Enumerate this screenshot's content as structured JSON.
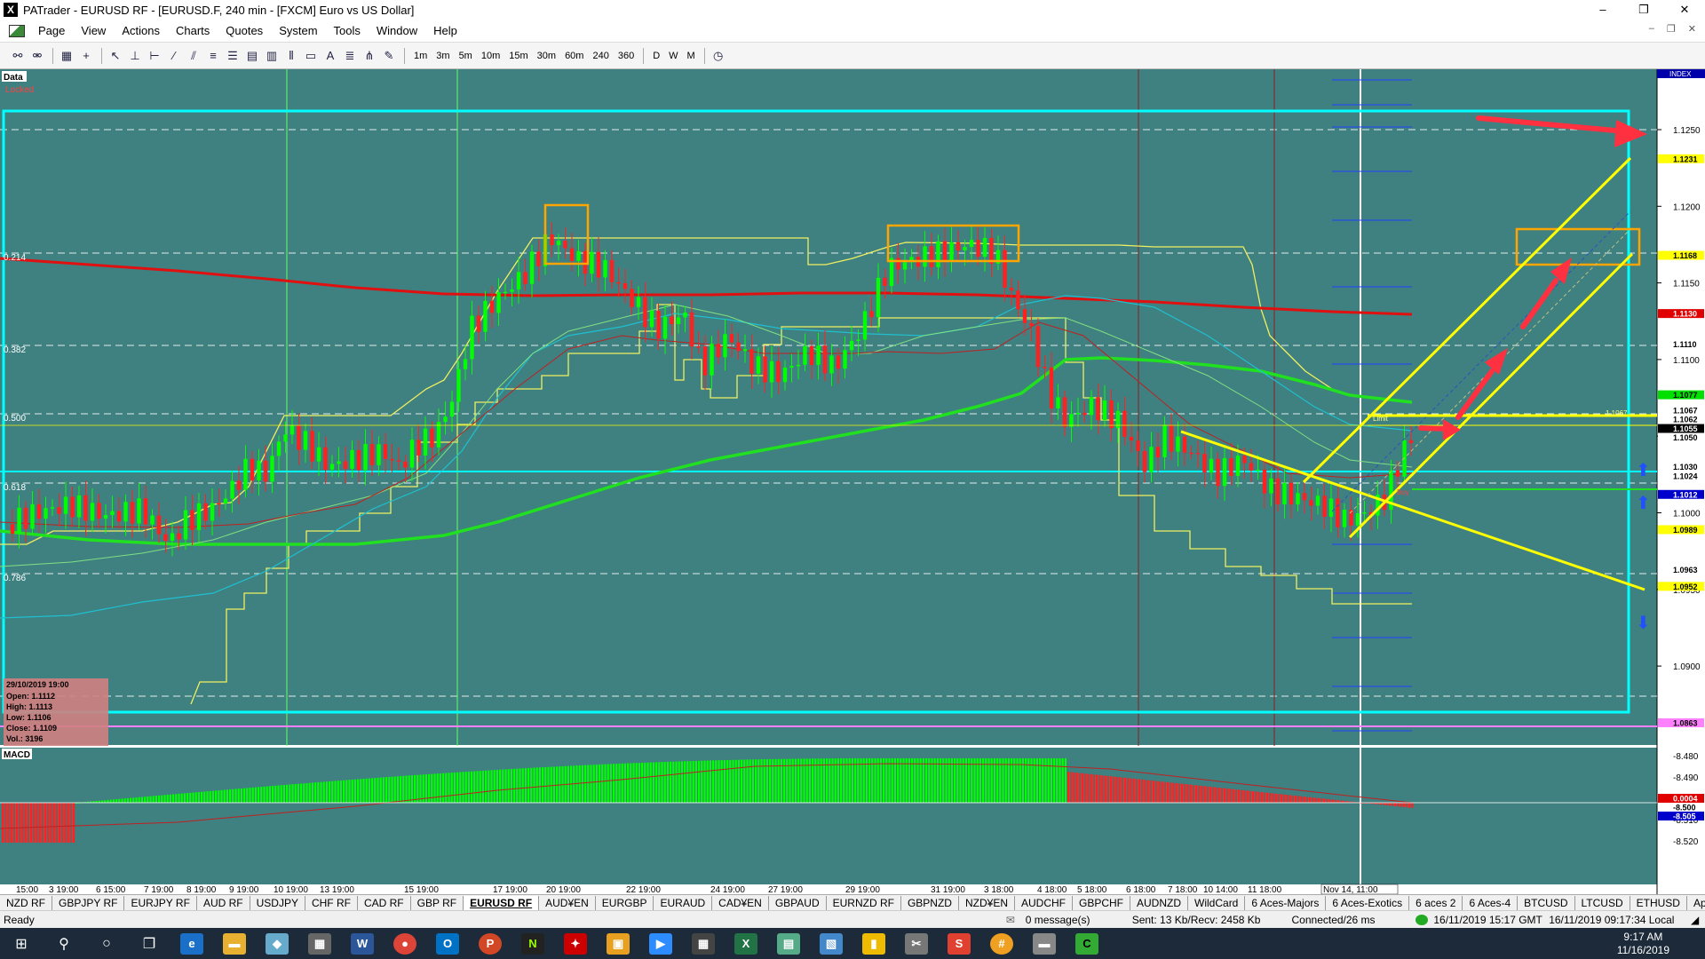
{
  "window": {
    "title": "PATrader - EURUSD RF - [EURUSD.F, 240 min - [FXCM] Euro vs US Dollar]",
    "app_icon": "X",
    "minimize": "–",
    "restore": "❐",
    "close": "✕"
  },
  "menu": [
    "Page",
    "View",
    "Actions",
    "Charts",
    "Quotes",
    "System",
    "Tools",
    "Window",
    "Help"
  ],
  "mdi": {
    "minimize": "–",
    "restore": "❐",
    "close": "✕"
  },
  "toolbar": {
    "timeframes": [
      "1m",
      "3m",
      "5m",
      "10m",
      "15m",
      "30m",
      "60m",
      "240",
      "360",
      "D",
      "W",
      "M"
    ]
  },
  "chart": {
    "data_label": "Data",
    "locked_label": "Locked",
    "index_label": "INDEX",
    "macd_label": "MACD",
    "y_ticks": [
      "1.1250",
      "1.1200",
      "1.1150",
      "1.1100",
      "1.1050",
      "1.1000",
      "1.0950",
      "1.0900"
    ],
    "price_tags": [
      {
        "text": "1.1231",
        "bg": "#ffff00",
        "color": "#000"
      },
      {
        "text": "1.1168",
        "bg": "#ffff00",
        "color": "#000"
      },
      {
        "text": "1.1130",
        "bg": "#e00000",
        "color": "#fff"
      },
      {
        "text": "1.1110",
        "bg": "#ffffff",
        "color": "#000"
      },
      {
        "text": "1.1077",
        "bg": "#00e000",
        "color": "#000"
      },
      {
        "text": "1.1067",
        "bg": "#ffffff",
        "color": "#000"
      },
      {
        "text": "1.1062",
        "bg": "#ffffff",
        "color": "#000"
      },
      {
        "text": "1.1055",
        "bg": "#000000",
        "color": "#fff"
      },
      {
        "text": "1.1050",
        "bg": "#ffffff",
        "color": "#000"
      },
      {
        "text": "1.1030",
        "bg": "#ffffff",
        "color": "#000"
      },
      {
        "text": "1.1024",
        "bg": "#ffffff",
        "color": "#000"
      },
      {
        "text": "1.1012",
        "bg": "#0000cc",
        "color": "#fff"
      },
      {
        "text": "1.0989",
        "bg": "#ffff00",
        "color": "#000"
      },
      {
        "text": "1.0963",
        "bg": "#ffffff",
        "color": "#000"
      },
      {
        "text": "1.0952",
        "bg": "#ffff00",
        "color": "#000"
      },
      {
        "text": "1.0863",
        "bg": "#ff80ff",
        "color": "#000"
      }
    ],
    "fib_labels": [
      "0.214",
      "0.382",
      "0.500",
      "0.618",
      "0.786"
    ],
    "macd_ticks": [
      "-8.480",
      "-8.490",
      "-8.500",
      "-8.510",
      "-8.520"
    ],
    "macd_tags": [
      {
        "text": "0.0004",
        "bg": "#e00000",
        "color": "#fff"
      },
      {
        "text": "-8.500",
        "bg": "#ffffff",
        "color": "#000"
      },
      {
        "text": "-8.505",
        "bg": "#0000cc",
        "color": "#fff"
      }
    ],
    "x_labels": [
      "15:00",
      "3 19:00",
      "6 15:00",
      "7 19:00",
      "8 19:00",
      "9 19:00",
      "10 19:00",
      "13 19:00",
      "15 19:00",
      "17 19:00",
      "20 19:00",
      "22 19:00",
      "24 19:00",
      "27 19:00",
      "29 19:00",
      "31 19:00",
      "3 18:00",
      "4 18:00",
      "5 18:00",
      "6 18:00",
      "7 18:00",
      "10 14:00",
      "11 18:00"
    ],
    "cursor_time": "Nov 14, 11:00",
    "small_labels": {
      "limit": "Limit",
      "buy": "Buy",
      "level": "1.1067"
    },
    "ohlc": {
      "date": "29/10/2019 19:00",
      "open": "Open: 1.1112",
      "high": "High: 1.1113",
      "low": "Low: 1.1106",
      "close": "Close: 1.1109",
      "vol": "Vol.: 3196"
    },
    "colors": {
      "bg": "#3f8080",
      "up": "#00ff00",
      "down": "#ff2020",
      "ma_red": "#e01010",
      "ma_green": "#20e020",
      "channel": "#ffff00",
      "box": "#ffa500",
      "cyan": "#00ffff",
      "arrow": "#ff3040"
    }
  },
  "tabs": [
    "NZD RF",
    "GBPJPY RF",
    "EURJPY RF",
    "AUD RF",
    "USDJPY",
    "CHF RF",
    "CAD RF",
    "GBP RF",
    "EURUSD RF",
    "AUD¥EN",
    "EURGBP",
    "EURAUD",
    "CAD¥EN",
    "GBPAUD",
    "EURNZD RF",
    "GBPNZD",
    "NZD¥EN",
    "AUDCHF",
    "GBPCHF",
    "AUDNZD",
    "WildCard",
    "6 Aces-Majors",
    "6 Aces-Exotics",
    "6 aces 2",
    "6 Aces-4",
    "BTCUSD",
    "LTCUSD",
    "ETHUSD",
    "Apple"
  ],
  "active_tab": "EURUSD RF",
  "status": {
    "ready": "Ready",
    "messages": "0 message(s)",
    "sent": "Sent: 13 Kb/Recv: 2458 Kb",
    "connected": "Connected/26 ms",
    "gmt": "16/11/2019 15:17 GMT",
    "local": "16/11/2019 09:17:34 Local"
  },
  "taskbar": {
    "time": "9:17 AM",
    "date": "11/16/2019"
  }
}
